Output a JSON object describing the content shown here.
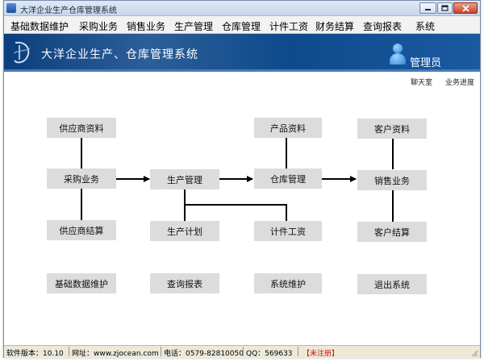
{
  "window": {
    "title": "大洋企业生产仓库管理系统"
  },
  "menu": [
    "基础数据维护",
    "采购业务",
    "销售业务",
    "生产管理",
    "仓库管理",
    "计件工资",
    "财务结算",
    "查询报表",
    "系统"
  ],
  "banner": {
    "title": "大洋企业生产、仓库管理系统",
    "user_label": "管理员"
  },
  "links": {
    "chat": "聊天室",
    "progress": "业务进度"
  },
  "flow": {
    "supplier_info": "供应商资料",
    "purchase": "采购业务",
    "supplier_settle": "供应商结算",
    "production_mgmt": "生产管理",
    "production_plan": "生产计划",
    "product_info": "产品资料",
    "warehouse_mgmt": "仓库管理",
    "piece_wage": "计件工资",
    "customer_info": "客户资料",
    "sales": "销售业务",
    "customer_settle": "客户结算",
    "basic_data": "基础数据维护",
    "query_reports": "查询报表",
    "system_maint": "系统维护",
    "exit": "退出系统"
  },
  "status": {
    "version": "软件版本：10.10",
    "website": "网址：www.zjocean.com",
    "phone": "电话：0579-82810050",
    "qq": "QQ：569633",
    "registration": "【未注册】"
  },
  "colors": {
    "banner": "#0e4a8c",
    "box": "#dcdcdc",
    "connector": "#000000",
    "unregistered": "#d01010"
  },
  "icons": {
    "app": "app-icon",
    "logo": "logo-icon",
    "user": "user-icon"
  }
}
